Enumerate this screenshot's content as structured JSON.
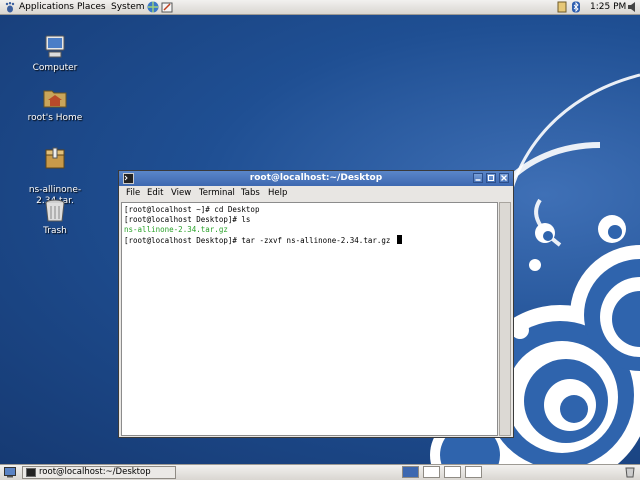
{
  "top_panel": {
    "menus": [
      "Applications",
      "Places",
      "System"
    ],
    "clock": "1:25 PM",
    "icons": [
      "apps-foot-icon",
      "browser-icon",
      "edit-icon",
      "notes-icon",
      "bluetooth-icon",
      "speaker-icon"
    ]
  },
  "desktop_icons": [
    {
      "label": "Computer",
      "icon": "computer-icon"
    },
    {
      "label": "root's Home",
      "icon": "home-folder-icon"
    },
    {
      "label": "ns-allinone-2.34.tar.\ngz",
      "icon": "archive-icon"
    },
    {
      "label": "Trash",
      "icon": "trash-icon"
    }
  ],
  "terminal": {
    "title": "root@localhost:~/Desktop",
    "menus": [
      "File",
      "Edit",
      "View",
      "Terminal",
      "Tabs",
      "Help"
    ],
    "lines": [
      {
        "text": "[root@localhost ~]# cd Desktop",
        "color": "#000000"
      },
      {
        "text": "[root@localhost Desktop]# ls",
        "color": "#000000"
      },
      {
        "text": "ns-allinone-2.34.tar.gz",
        "color": "#2aa22a"
      },
      {
        "text": "[root@localhost Desktop]# tar -zxvf ns-allinone-2.34.tar.gz ",
        "color": "#000000"
      }
    ]
  },
  "bottom_panel": {
    "task": "root@localhost:~/Desktop",
    "workspaces": 4
  },
  "colors": {
    "title_bar": "#3d68b0",
    "desktop": "#1f4f93",
    "panel": "#d9d6d1"
  }
}
